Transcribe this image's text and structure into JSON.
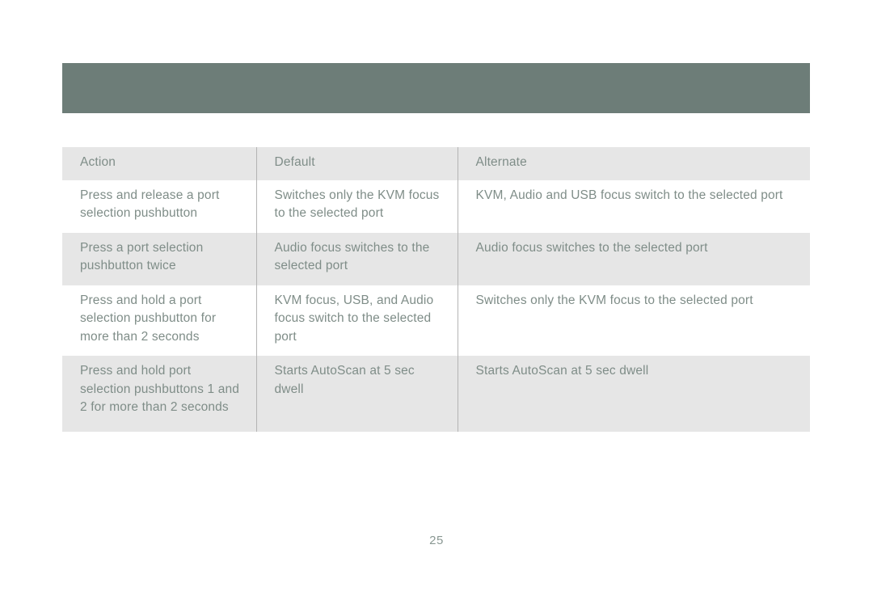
{
  "page": {
    "number": "25",
    "background_color": "#ffffff"
  },
  "header_band": {
    "name": "decorative-header-band",
    "color": "#6d7d78",
    "text": ""
  },
  "table": {
    "accent_color": "#6d7d78",
    "text_color": "#7f8d88",
    "shaded_row_color": "#e6e6e6",
    "divider_color": "#b4b4b4",
    "columns": [
      {
        "key": "action",
        "label": "Action"
      },
      {
        "key": "default",
        "label": "Default"
      },
      {
        "key": "alternate",
        "label": "Alternate"
      }
    ],
    "rows": [
      {
        "action": "Press and release a port selection pushbutton",
        "default": "Switches only the KVM focus to the selected port",
        "alternate": "KVM, Audio and USB focus switch to the selected port"
      },
      {
        "action": "Press a port selection pushbutton twice",
        "default": "Audio focus switches to the selected port",
        "alternate": "Audio focus switches to the selected port"
      },
      {
        "action": "Press and hold a port selection pushbutton for more than 2 seconds",
        "default": "KVM focus, USB, and Audio focus switch to the selected port",
        "alternate": "Switches only the KVM focus to the selected port"
      },
      {
        "action": "Press and hold port selection pushbuttons 1 and 2 for more than 2 seconds",
        "default": "Starts AutoScan at 5 sec dwell",
        "alternate": "Starts AutoScan at 5 sec dwell"
      }
    ]
  }
}
